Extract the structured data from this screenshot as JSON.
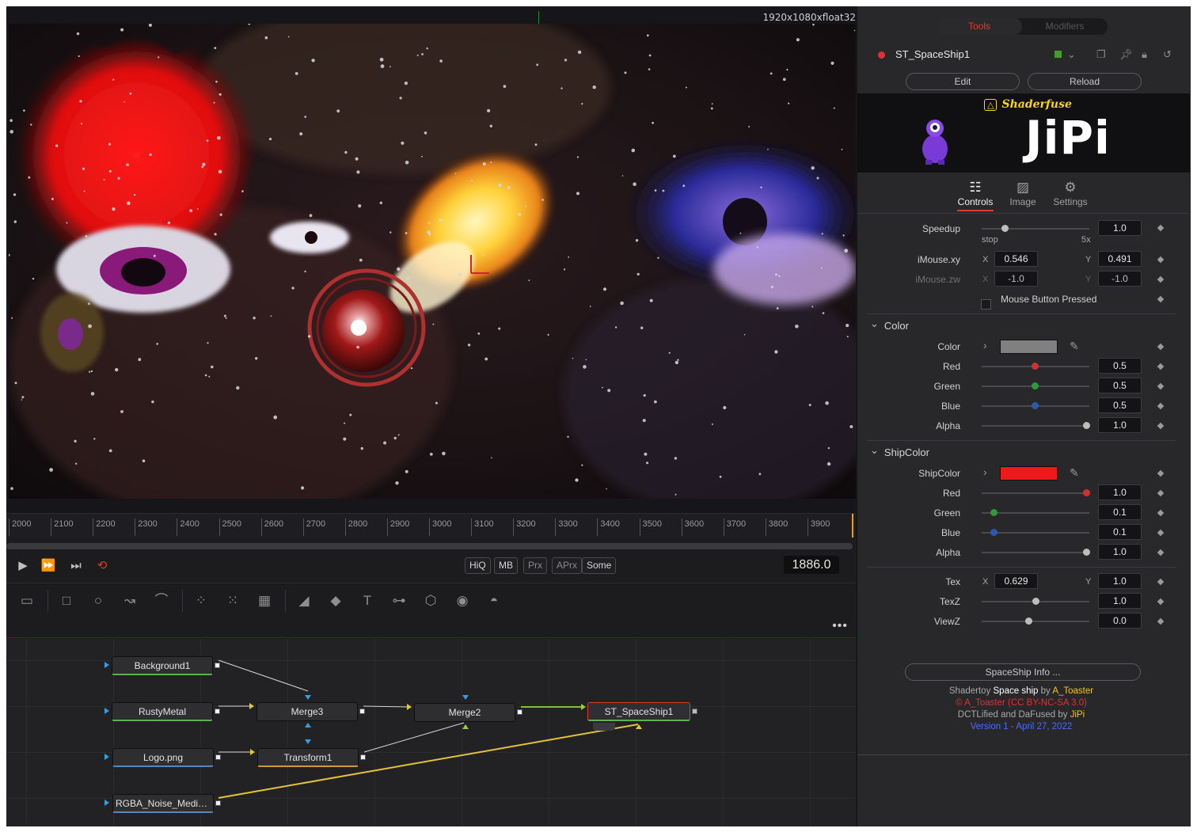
{
  "viewer": {
    "resolution_label": "1920x1080xfloat32"
  },
  "ruler": {
    "ticks": [
      "2000",
      "2100",
      "2200",
      "2300",
      "2400",
      "2500",
      "2600",
      "2700",
      "2800",
      "2900",
      "3000",
      "3100",
      "3200",
      "3300",
      "3400",
      "3500",
      "3600",
      "3700",
      "3800",
      "3900"
    ]
  },
  "transport": {
    "play_icon": "play-icon",
    "fast_forward_icon": "fast-forward-icon",
    "skip_end_icon": "skip-to-end-icon",
    "loop_icon": "loop-icon",
    "quality_buttons": [
      {
        "label": "HiQ",
        "active": true
      },
      {
        "label": "MB",
        "active": true
      },
      {
        "label": "Prx",
        "active": false
      },
      {
        "label": "APrx",
        "active": false
      },
      {
        "label": "Some",
        "active": true
      }
    ],
    "current_frame": "1886.0"
  },
  "toolbar": {
    "tools": [
      "background-tool-icon",
      "rectangle-mask-icon",
      "ellipse-mask-icon",
      "polygon-mask-icon",
      "bspline-mask-icon",
      "particle-emitter-icon",
      "particle-render-icon",
      "particle-style-icon",
      "image-plane-3d-icon",
      "shape-3d-icon",
      "text-3d-icon",
      "merge-3d-icon",
      "renderer-3d-icon",
      "camera-3d-icon",
      "light-3d-icon"
    ]
  },
  "node_editor": {
    "menu_label": "•••",
    "nodes": {
      "background1": "Background1",
      "rustymetal": "RustyMetal",
      "logo": "Logo.png",
      "noise": "RGBA_Noise_Medium...",
      "merge3": "Merge3",
      "transform1": "Transform1",
      "merge2": "Merge2",
      "spaceship": "ST_SpaceShip1"
    }
  },
  "inspector": {
    "tabs": [
      {
        "label": "Tools",
        "active": true
      },
      {
        "label": "Modifiers",
        "active": false
      }
    ],
    "tool_name": "ST_SpaceShip1",
    "tool_color": "#4a9a2a",
    "header_icons": [
      "chevron-down-icon",
      "versions-icon",
      "pin-icon",
      "lock-icon",
      "reset-icon"
    ],
    "edit_label": "Edit",
    "reload_label": "Reload",
    "shaderfuse_label": "Shaderfuse",
    "author_banner": "JiPi",
    "subtabs": [
      {
        "label": "Controls",
        "icon": "controls-icon",
        "active": true
      },
      {
        "label": "Image",
        "icon": "image-icon",
        "active": false
      },
      {
        "label": "Settings",
        "icon": "settings-icon",
        "active": false
      }
    ],
    "controls": {
      "speedup": {
        "label": "Speedup",
        "value": "1.0",
        "min_label": "stop",
        "max_label": "5x",
        "level": 0.2
      },
      "imouse_xy": {
        "label": "iMouse.xy",
        "x_label": "X",
        "x": "0.546",
        "y_label": "Y",
        "y": "0.491"
      },
      "imouse_zw": {
        "label": "iMouse.zw",
        "x_label": "X",
        "x": "-1.0",
        "y_label": "Y",
        "y": "-1.0"
      },
      "mouse_pressed": {
        "label": "Mouse Button Pressed",
        "checked": false
      }
    },
    "color_section": {
      "title": "Color",
      "label": "Color",
      "swatch": "#808080",
      "red": {
        "label": "Red",
        "value": "0.5",
        "level": 0.5,
        "color": "#d23030"
      },
      "green": {
        "label": "Green",
        "value": "0.5",
        "level": 0.5,
        "color": "#2e9a3a"
      },
      "blue": {
        "label": "Blue",
        "value": "0.5",
        "level": 0.5,
        "color": "#2a5ab0"
      },
      "alpha": {
        "label": "Alpha",
        "value": "1.0",
        "level": 1.0
      }
    },
    "shipcolor_section": {
      "title": "ShipColor",
      "label": "ShipColor",
      "swatch": "#ee1a1a",
      "red": {
        "label": "Red",
        "value": "1.0",
        "level": 1.0,
        "color": "#d23030"
      },
      "green": {
        "label": "Green",
        "value": "0.1",
        "level": 0.1,
        "color": "#2e9a3a"
      },
      "blue": {
        "label": "Blue",
        "value": "0.1",
        "level": 0.1,
        "color": "#2a5ab0"
      },
      "alpha": {
        "label": "Alpha",
        "value": "1.0",
        "level": 1.0
      }
    },
    "tex": {
      "label": "Tex",
      "x_label": "X",
      "x": "0.629",
      "y_label": "Y",
      "y": "1.0"
    },
    "texz": {
      "label": "TexZ",
      "value": "1.0",
      "level": 0.5
    },
    "viewz": {
      "label": "ViewZ",
      "value": "0.0",
      "level": 0.5
    },
    "info_button": "SpaceShip Info ...",
    "credits": {
      "line1_a": "Shadertoy ",
      "line1_b": "Space ship",
      "line1_c": " by ",
      "line1_d": "A_Toaster",
      "line2": "© A_Toaster (CC BY-NC-SA 3.0)",
      "line3_a": "DCTLified and DaFused by ",
      "line3_b": "JiPi",
      "line4": "Version 1 - April 27, 2022"
    }
  }
}
